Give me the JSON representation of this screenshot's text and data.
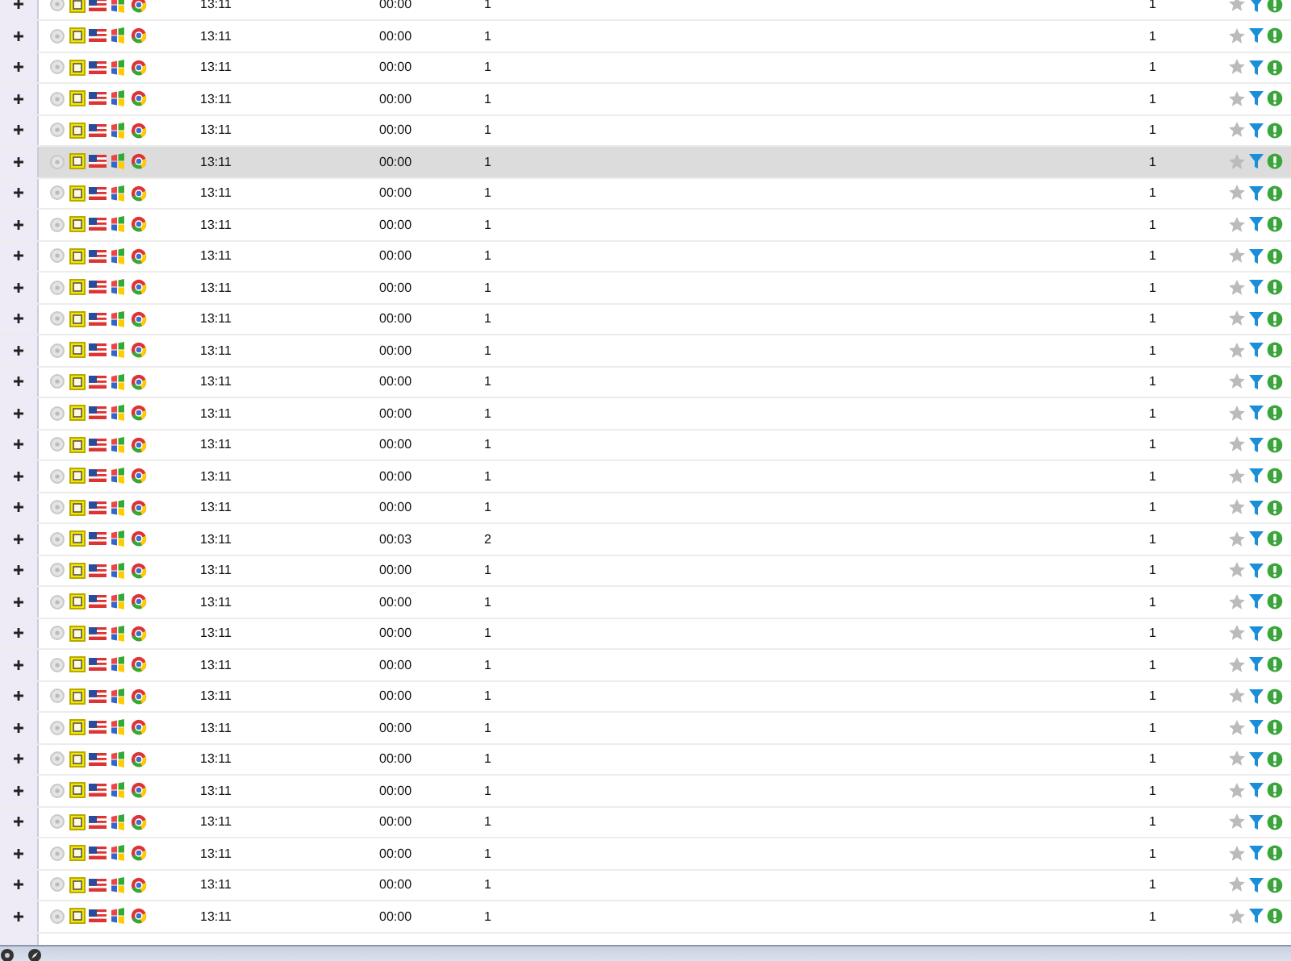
{
  "rows": [
    {
      "time": "13:11",
      "duration": "00:00",
      "column_3": "1",
      "column_4": "1",
      "selected": false
    },
    {
      "time": "13:11",
      "duration": "00:00",
      "column_3": "1",
      "column_4": "1",
      "selected": false
    },
    {
      "time": "13:11",
      "duration": "00:00",
      "column_3": "1",
      "column_4": "1",
      "selected": false
    },
    {
      "time": "13:11",
      "duration": "00:00",
      "column_3": "1",
      "column_4": "1",
      "selected": false
    },
    {
      "time": "13:11",
      "duration": "00:00",
      "column_3": "1",
      "column_4": "1",
      "selected": false
    },
    {
      "time": "13:11",
      "duration": "00:00",
      "column_3": "1",
      "column_4": "1",
      "selected": true
    },
    {
      "time": "13:11",
      "duration": "00:00",
      "column_3": "1",
      "column_4": "1",
      "selected": false
    },
    {
      "time": "13:11",
      "duration": "00:00",
      "column_3": "1",
      "column_4": "1",
      "selected": false
    },
    {
      "time": "13:11",
      "duration": "00:00",
      "column_3": "1",
      "column_4": "1",
      "selected": false
    },
    {
      "time": "13:11",
      "duration": "00:00",
      "column_3": "1",
      "column_4": "1",
      "selected": false
    },
    {
      "time": "13:11",
      "duration": "00:00",
      "column_3": "1",
      "column_4": "1",
      "selected": false
    },
    {
      "time": "13:11",
      "duration": "00:00",
      "column_3": "1",
      "column_4": "1",
      "selected": false
    },
    {
      "time": "13:11",
      "duration": "00:00",
      "column_3": "1",
      "column_4": "1",
      "selected": false
    },
    {
      "time": "13:11",
      "duration": "00:00",
      "column_3": "1",
      "column_4": "1",
      "selected": false
    },
    {
      "time": "13:11",
      "duration": "00:00",
      "column_3": "1",
      "column_4": "1",
      "selected": false
    },
    {
      "time": "13:11",
      "duration": "00:00",
      "column_3": "1",
      "column_4": "1",
      "selected": false
    },
    {
      "time": "13:11",
      "duration": "00:00",
      "column_3": "1",
      "column_4": "1",
      "selected": false
    },
    {
      "time": "13:11",
      "duration": "00:03",
      "column_3": "2",
      "column_4": "1",
      "selected": false
    },
    {
      "time": "13:11",
      "duration": "00:00",
      "column_3": "1",
      "column_4": "1",
      "selected": false
    },
    {
      "time": "13:11",
      "duration": "00:00",
      "column_3": "1",
      "column_4": "1",
      "selected": false
    },
    {
      "time": "13:11",
      "duration": "00:00",
      "column_3": "1",
      "column_4": "1",
      "selected": false
    },
    {
      "time": "13:11",
      "duration": "00:00",
      "column_3": "1",
      "column_4": "1",
      "selected": false
    },
    {
      "time": "13:11",
      "duration": "00:00",
      "column_3": "1",
      "column_4": "1",
      "selected": false
    },
    {
      "time": "13:11",
      "duration": "00:00",
      "column_3": "1",
      "column_4": "1",
      "selected": false
    },
    {
      "time": "13:11",
      "duration": "00:00",
      "column_3": "1",
      "column_4": "1",
      "selected": false
    },
    {
      "time": "13:11",
      "duration": "00:00",
      "column_3": "1",
      "column_4": "1",
      "selected": false
    },
    {
      "time": "13:11",
      "duration": "00:00",
      "column_3": "1",
      "column_4": "1",
      "selected": false
    },
    {
      "time": "13:11",
      "duration": "00:00",
      "column_3": "1",
      "column_4": "1",
      "selected": false
    },
    {
      "time": "13:11",
      "duration": "00:00",
      "column_3": "1",
      "column_4": "1",
      "selected": false
    },
    {
      "time": "13:11",
      "duration": "00:00",
      "column_3": "1",
      "column_4": "1",
      "selected": false
    }
  ]
}
